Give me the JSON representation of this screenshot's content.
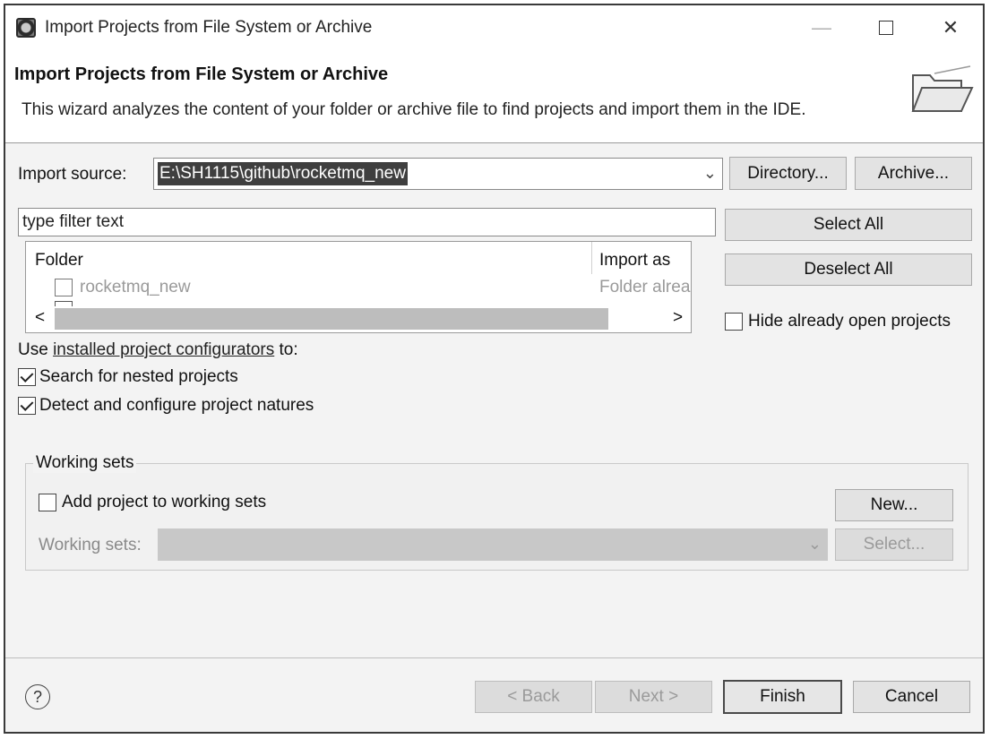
{
  "window": {
    "title": "Import Projects from File System or Archive",
    "controls": {
      "minimize": "—",
      "close": "✕"
    }
  },
  "header": {
    "title": "Import Projects from File System or Archive",
    "description": "This wizard analyzes the content of your folder or archive file to find projects and import them in the IDE."
  },
  "import_source": {
    "label": "Import source:",
    "value": "E:\\SH1115\\github\\rocketmq_new",
    "directory_button": "Directory...",
    "archive_button": "Archive..."
  },
  "filter": {
    "placeholder": "type filter text"
  },
  "table": {
    "columns": [
      "Folder",
      "Import as"
    ],
    "rows": [
      {
        "folder": "rocketmq_new",
        "import_as": "Folder alrea",
        "checked": false
      }
    ],
    "scroll_up": "^",
    "scroll_down": "v",
    "scroll_left": "<",
    "scroll_right": ">"
  },
  "side_buttons": {
    "select_all": "Select All",
    "deselect_all": "Deselect All",
    "hide_open": "Hide already open projects"
  },
  "configurators": {
    "prefix": "Use",
    "link": "installed project configurators",
    "suffix": "to:",
    "search_nested": "Search for nested projects",
    "detect_natures": "Detect and configure project natures"
  },
  "working_sets": {
    "group_title": "Working sets",
    "add_label": "Add project to working sets",
    "new_button": "New...",
    "sets_label": "Working sets:",
    "select_button": "Select..."
  },
  "footer": {
    "help": "?",
    "back": "< Back",
    "next": "Next >",
    "finish": "Finish",
    "cancel": "Cancel"
  },
  "icons": {
    "app": "eclipse-app-icon",
    "folder": "folder-icon",
    "help": "help-icon",
    "dropdown": "chevron-down-icon"
  }
}
